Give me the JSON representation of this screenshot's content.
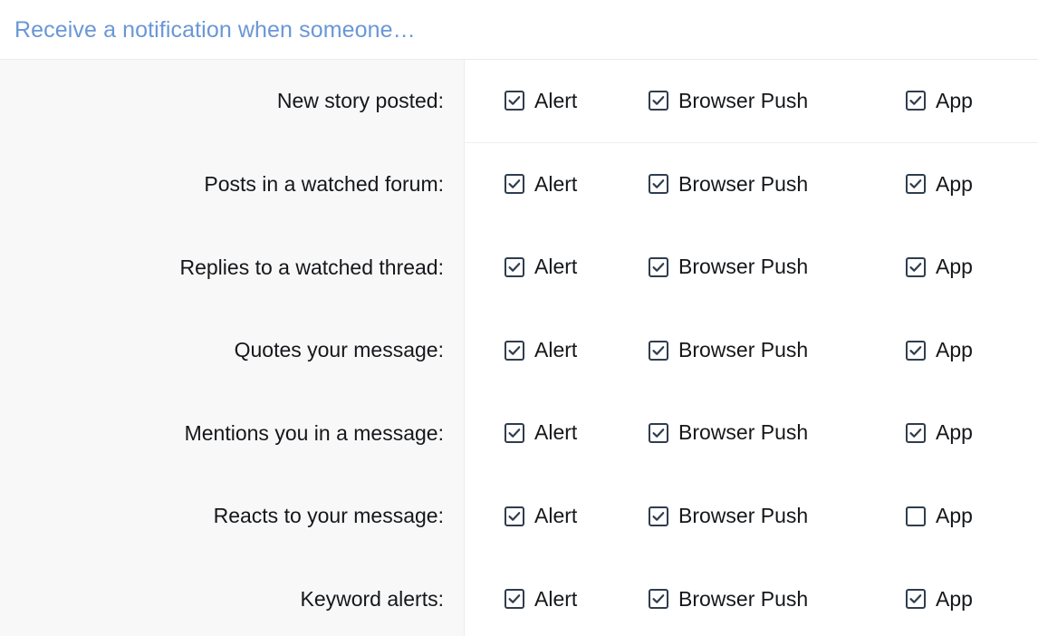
{
  "header": {
    "title": "Receive a notification when someone…",
    "title_color": "#6a97d6"
  },
  "columns": [
    {
      "key": "alert",
      "label": "Alert"
    },
    {
      "key": "push",
      "label": "Browser Push"
    },
    {
      "key": "app",
      "label": "App"
    }
  ],
  "theme": {
    "gutter_bg": "#f8f8f9",
    "divider": "#eceef0",
    "checkbox_border": "#2f3d4e",
    "text": "#15171a"
  },
  "rows": [
    {
      "label": "New story posted:",
      "divided": true,
      "alert": {
        "label": "Alert",
        "checked": true
      },
      "push": {
        "label": "Browser Push",
        "checked": true
      },
      "app": {
        "label": "App",
        "checked": true
      }
    },
    {
      "label": "Posts in a watched forum:",
      "divided": false,
      "alert": {
        "label": "Alert",
        "checked": true
      },
      "push": {
        "label": "Browser Push",
        "checked": true
      },
      "app": {
        "label": "App",
        "checked": true
      }
    },
    {
      "label": "Replies to a watched thread:",
      "divided": false,
      "alert": {
        "label": "Alert",
        "checked": true
      },
      "push": {
        "label": "Browser Push",
        "checked": true
      },
      "app": {
        "label": "App",
        "checked": true
      }
    },
    {
      "label": "Quotes your message:",
      "divided": false,
      "alert": {
        "label": "Alert",
        "checked": true
      },
      "push": {
        "label": "Browser Push",
        "checked": true
      },
      "app": {
        "label": "App",
        "checked": true
      }
    },
    {
      "label": "Mentions you in a message:",
      "divided": false,
      "alert": {
        "label": "Alert",
        "checked": true
      },
      "push": {
        "label": "Browser Push",
        "checked": true
      },
      "app": {
        "label": "App",
        "checked": true
      }
    },
    {
      "label": "Reacts to your message:",
      "divided": false,
      "alert": {
        "label": "Alert",
        "checked": true
      },
      "push": {
        "label": "Browser Push",
        "checked": true
      },
      "app": {
        "label": "App",
        "checked": false
      }
    },
    {
      "label": "Keyword alerts:",
      "divided": false,
      "alert": {
        "label": "Alert",
        "checked": true
      },
      "push": {
        "label": "Browser Push",
        "checked": true
      },
      "app": {
        "label": "App",
        "checked": true
      }
    }
  ]
}
